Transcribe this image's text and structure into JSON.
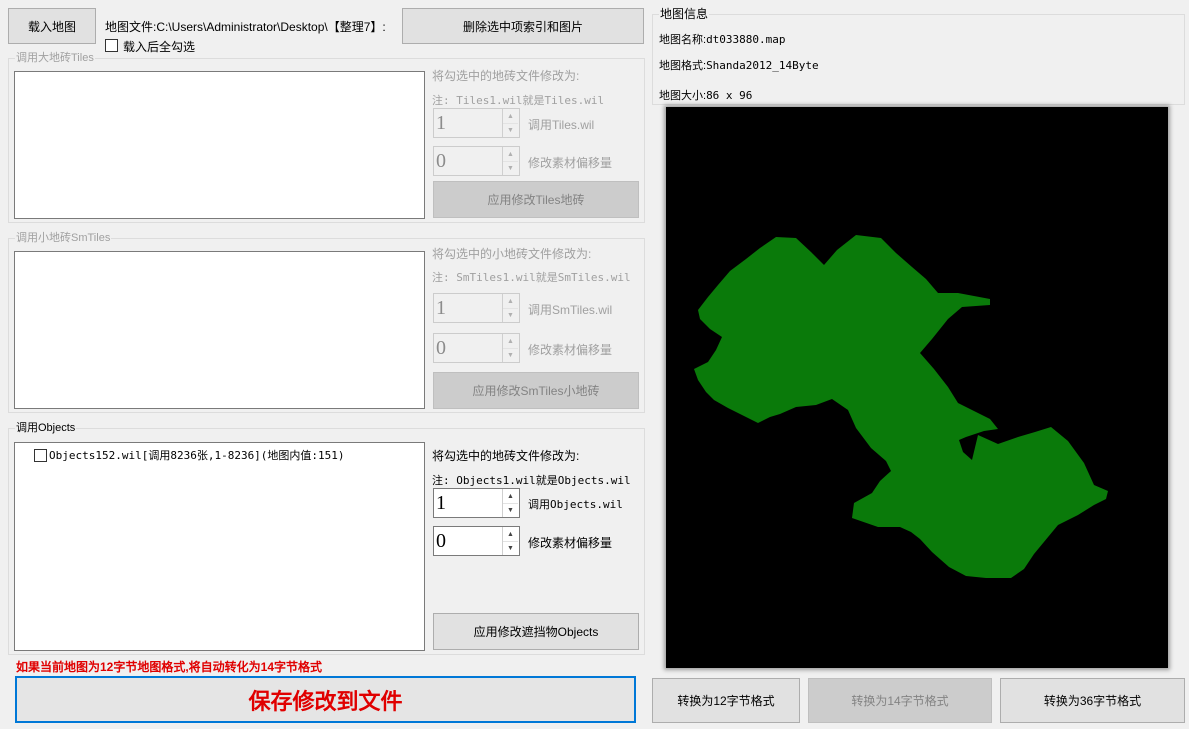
{
  "toolbar": {
    "load_map_label": "载入地图",
    "map_file_label": "地图文件:C:\\Users\\Administrator\\Desktop\\【整理7】:",
    "delete_selected_label": "删除选中项索引和图片",
    "check_all_on_load_label": "载入后全勾选"
  },
  "tiles": {
    "title": "调用大地砖Tiles",
    "modify_label": "将勾选中的地砖文件修改为:",
    "note": "注: Tiles1.wil就是Tiles.wil",
    "file_index_value": "1",
    "file_index_label": "调用Tiles.wil",
    "offset_value": "0",
    "offset_label": "修改素材偏移量",
    "apply_label": "应用修改Tiles地砖"
  },
  "smtiles": {
    "title": "调用小地砖SmTiles",
    "modify_label": "将勾选中的小地砖文件修改为:",
    "note": "注: SmTiles1.wil就是SmTiles.wil",
    "file_index_value": "1",
    "file_index_label": "调用SmTiles.wil",
    "offset_value": "0",
    "offset_label": "修改素材偏移量",
    "apply_label": "应用修改SmTiles小地砖"
  },
  "objects": {
    "title": "调用Objects",
    "items": [
      {
        "label": "Objects152.wil[调用8236张,1-8236](地图内值:151)",
        "checked": false
      }
    ],
    "modify_label": "将勾选中的地砖文件修改为:",
    "note": "注: Objects1.wil就是Objects.wil",
    "file_index_value": "1",
    "file_index_label": "调用Objects.wil",
    "offset_value": "0",
    "offset_label": "修改素材偏移量",
    "apply_label": "应用修改遮挡物Objects"
  },
  "warning": {
    "text": "如果当前地图为12字节地图格式,将自动转化为14字节格式",
    "color": "#e00000"
  },
  "save_button_label": "保存修改到文件",
  "save_button_color": "#e00000",
  "map_info": {
    "title": "地图信息",
    "name_label": "地图名称:",
    "name_value": "dt033880.map",
    "format_label": "地图格式:",
    "format_value": "Shanda2012_14Byte",
    "size_label": "地图大小:",
    "size_value": "86 x 96"
  },
  "preview": {
    "background": "#000000",
    "land_color": "#0a7a0a"
  },
  "convert": {
    "to12_label": "转换为12字节格式",
    "to14_label": "转换为14字节格式",
    "to36_label": "转换为36字节格式"
  }
}
